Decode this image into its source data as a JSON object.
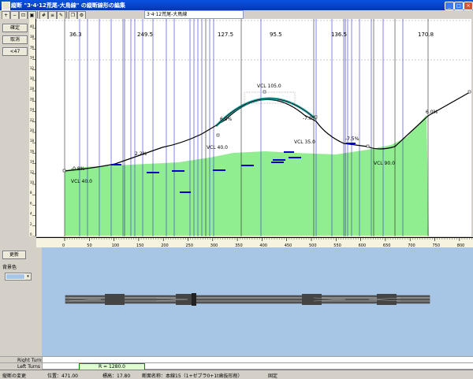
{
  "window": {
    "title": "縦断 \"3·4·12荒尾-大鳥線\" の縦断線形の編集",
    "controls": [
      "_",
      "□",
      "×"
    ]
  },
  "toolbar": {
    "icons": [
      "zoom-in-icon",
      "zoom-out-icon",
      "zoom-fit-icon",
      "zoom-window-icon",
      "grid-icon",
      "layers-icon",
      "copy-icon",
      "settings-icon"
    ],
    "route_select": "3·4·12荒尾-大鳥線"
  },
  "left_buttons": {
    "confirm": "確定",
    "cancel": "取消",
    "grade_option": "<47"
  },
  "profile": {
    "top_values": [
      "36.3",
      "249.5",
      "127.5",
      "95.5",
      "136.5",
      "170.8"
    ],
    "grade_labels": [
      "-0.8%",
      "2.2%",
      "6.0%",
      "-7.0%",
      "-7.5%",
      "6.0%"
    ],
    "vcl_labels": [
      "VCL 40.0",
      "VCL 40.0",
      "VCL 105.0",
      "VCL 35.0",
      "VCL 90.0"
    ],
    "x_ticks": [
      "0",
      "50",
      "100",
      "150",
      "200",
      "250",
      "300",
      "350",
      "400",
      "450",
      "500",
      "550",
      "600",
      "650",
      "700",
      "750",
      "800"
    ],
    "y_ticks": [
      "0",
      "2",
      "4",
      "6",
      "8",
      "10",
      "12",
      "14",
      "16",
      "18",
      "20",
      "22",
      "24",
      "26",
      "28",
      "30",
      "32",
      "34",
      "36",
      "38",
      "40"
    ],
    "colors": {
      "ground": "#90ee90",
      "profile_line": "#000000",
      "curve_highlight": "#00a0a0",
      "structure_line": "#3333cc",
      "bridge_bar": "#0000cc",
      "grid": "#808080"
    }
  },
  "plan_panel": {
    "update_button": "更新",
    "bg_color_label": "背景色",
    "bg_color": "#a7c5e4",
    "right_turns_label": "Right Turns",
    "left_turns_label": "Left Turns",
    "curve_radius": "R = 1280.0"
  },
  "status": {
    "mode": "縦断の変更",
    "position": "位置：471.00",
    "elevation": "標高：17.80",
    "section_name": "断面名称：本線15（1+ゼブラ0+1t歯抜形削）",
    "fixed": "固定"
  }
}
